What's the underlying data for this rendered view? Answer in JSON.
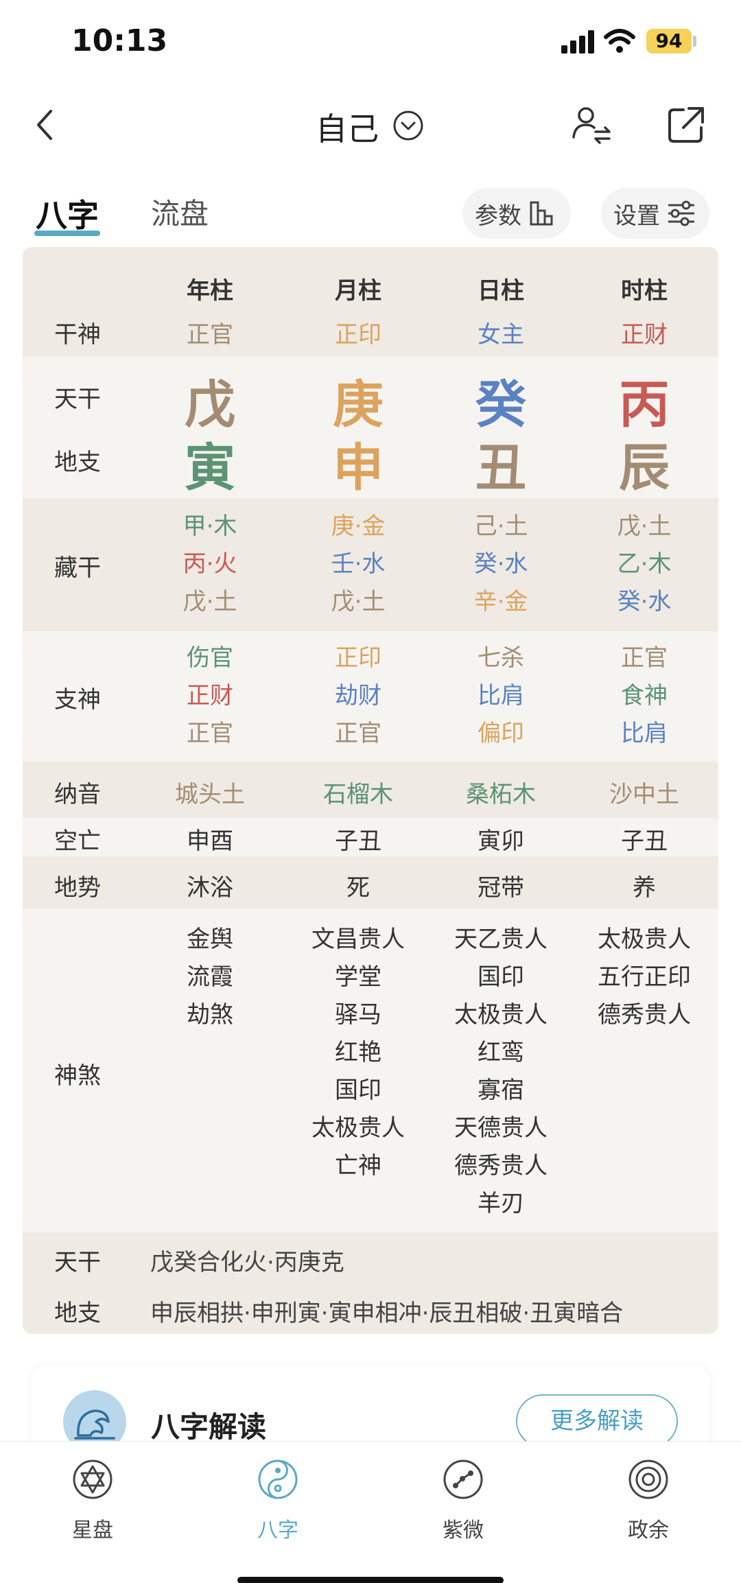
{
  "status": {
    "time": "10:13",
    "battery": "94"
  },
  "nav": {
    "title": "自己"
  },
  "tabs": {
    "bazi": "八字",
    "liupan": "流盘",
    "params": "参数",
    "settings": "设置"
  },
  "chart": {
    "columns": [
      "年柱",
      "月柱",
      "日柱",
      "时柱"
    ],
    "rows": {
      "ganshen": {
        "label": "干神",
        "values": [
          "正官",
          "正印",
          "女主",
          "正财"
        ]
      },
      "tiangan": {
        "label": "天干",
        "values": [
          "戊",
          "庚",
          "癸",
          "丙"
        ]
      },
      "dizhi": {
        "label": "地支",
        "values": [
          "寅",
          "申",
          "丑",
          "辰"
        ]
      },
      "canggan": {
        "label": "藏干",
        "values": [
          [
            "甲·木",
            "丙·火",
            "戊·土"
          ],
          [
            "庚·金",
            "壬·水",
            "戊·土"
          ],
          [
            "己·土",
            "癸·水",
            "辛·金"
          ],
          [
            "戊·土",
            "乙·木",
            "癸·水"
          ]
        ]
      },
      "zhishen": {
        "label": "支神",
        "values": [
          [
            "伤官",
            "正财",
            "正官"
          ],
          [
            "正印",
            "劫财",
            "正官"
          ],
          [
            "七杀",
            "比肩",
            "偏印"
          ],
          [
            "正官",
            "食神",
            "比肩"
          ]
        ]
      },
      "nayin": {
        "label": "纳音",
        "values": [
          "城头土",
          "石榴木",
          "桑柘木",
          "沙中土"
        ]
      },
      "kongwang": {
        "label": "空亡",
        "values": [
          "申酉",
          "子丑",
          "寅卯",
          "子丑"
        ]
      },
      "dishi": {
        "label": "地势",
        "values": [
          "沐浴",
          "死",
          "冠带",
          "养"
        ]
      },
      "shensha": {
        "label": "神煞",
        "values": [
          [
            "金舆",
            "流霞",
            "劫煞"
          ],
          [
            "文昌贵人",
            "学堂",
            "驿马",
            "红艳",
            "国印",
            "太极贵人",
            "亡神"
          ],
          [
            "天乙贵人",
            "国印",
            "太极贵人",
            "红鸾",
            "寡宿",
            "天德贵人",
            "德秀贵人",
            "羊刃"
          ],
          [
            "太极贵人",
            "五行正印",
            "德秀贵人"
          ]
        ]
      }
    },
    "relations": {
      "tiangan": {
        "label": "天干",
        "text": "戊癸合化火·丙庚克"
      },
      "dizhi": {
        "label": "地支",
        "text": "申辰相拱·申刑寅·寅申相冲·辰丑相破·丑寅暗合"
      }
    }
  },
  "card": {
    "title": "八字解读",
    "more": "更多解读"
  },
  "tabbar": {
    "items": [
      "星盘",
      "八字",
      "紫微",
      "政余"
    ]
  },
  "colors": {
    "accent": "#5aa9c6",
    "wood": "#5c9373",
    "fire": "#c85a55",
    "earth": "#a38c72",
    "metal": "#dca35e",
    "water": "#5a82c2"
  }
}
